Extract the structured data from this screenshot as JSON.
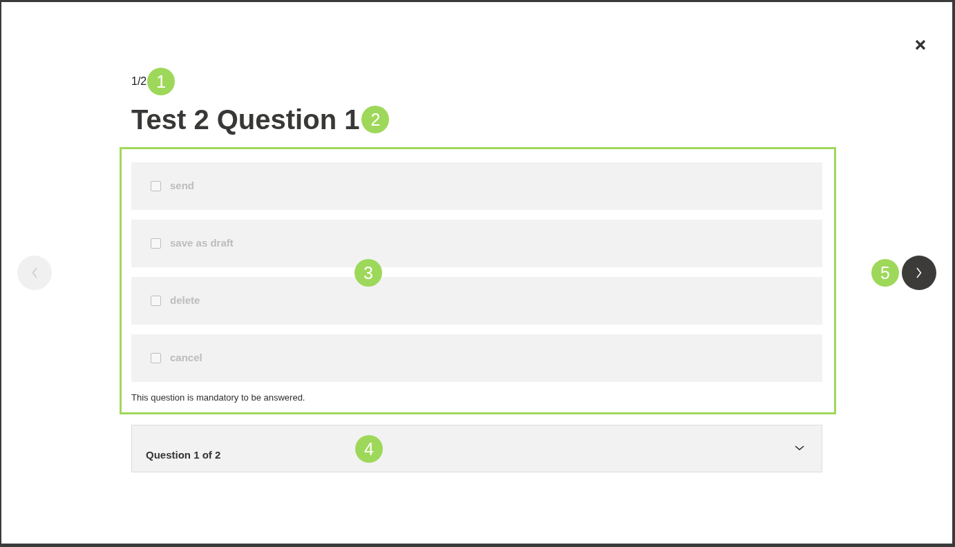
{
  "counter": {
    "text": "1/2",
    "callout": "1"
  },
  "title": {
    "text": "Test 2 Question 1",
    "callout": "2"
  },
  "question": {
    "highlighted": true,
    "callout": "3",
    "options": [
      {
        "label": "send",
        "checked": false
      },
      {
        "label": "save as draft",
        "checked": false
      },
      {
        "label": "delete",
        "checked": false
      },
      {
        "label": "cancel",
        "checked": false
      }
    ],
    "note": "This question is mandatory to be answered."
  },
  "accordion": {
    "label": "Question 1 of 2",
    "expanded": false,
    "callout": "4"
  },
  "navigation": {
    "previous": {
      "disabled": true
    },
    "next": {
      "disabled": false,
      "callout": "5"
    }
  }
}
